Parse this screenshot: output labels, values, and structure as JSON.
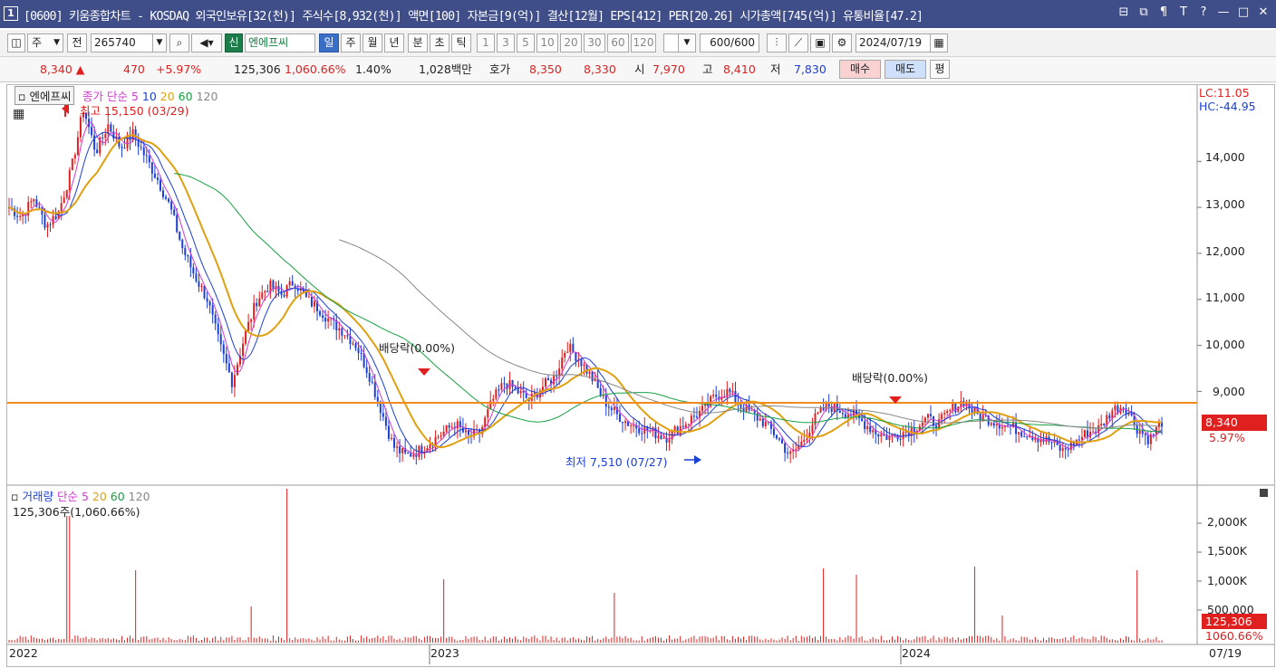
{
  "window": {
    "number": "1",
    "title": "[0600] 키움종합차트 - KOSDAQ 외국인보유[32(천)] 주식수[8,932(천)] 액면[100] 자본금[9(억)] 결산[12월] EPS[412] PER[20.26] 시가총액[745(억)] 유통비율[47.2]",
    "controls": [
      "⊟",
      "⧉",
      "¶",
      "T",
      "?",
      "—",
      "□",
      "✕"
    ]
  },
  "toolbar": {
    "market": "주",
    "prev_label": "전",
    "code": "265740",
    "new_badge": "신",
    "stock_name": "엔에프씨",
    "periods": [
      "일",
      "주",
      "월",
      "년",
      "분",
      "초",
      "틱"
    ],
    "active_period": "일",
    "minutes": [
      "1",
      "3",
      "5",
      "10",
      "20",
      "30",
      "60",
      "120"
    ],
    "count": "600/600",
    "date": "2024/07/19"
  },
  "info": {
    "price": "8,340",
    "change": "470",
    "change_pct": "+5.97%",
    "volume": "125,306",
    "volume_ratio": "1,060.66%",
    "turnover": "1.40%",
    "amount": "1,028백만",
    "quote_label": "호가",
    "ask": "8,350",
    "bid": "8,330",
    "open_label": "시",
    "open": "7,970",
    "high_label": "고",
    "high": "8,410",
    "low_label": "저",
    "low": "7,830",
    "buy_label": "매수",
    "sell_label": "매도",
    "flat_label": "평"
  },
  "price_panel": {
    "stock_tag": "엔에프씨",
    "ma_legend": [
      "종가 단순 5",
      "10",
      "20",
      "60",
      "120"
    ],
    "high_note": "최고 15,150 (03/29)",
    "low_note": "최저 7,510 (07/27)",
    "dividend_note_1": "배당락(0.00%)",
    "dividend_note_2": "배당락(0.00%)",
    "lc": "LC:11.05",
    "hc": "HC:-44.95",
    "y_ticks": [
      "14,000",
      "13,000",
      "12,000",
      "11,000",
      "10,000",
      "9,000"
    ],
    "last_price": "8,340",
    "last_pct": "5.97%"
  },
  "volume_panel": {
    "legend": [
      "거래량",
      "단순 5",
      "20",
      "60",
      "120"
    ],
    "current": "125,306주(1,060.66%)",
    "y_ticks": [
      "2,000K",
      "1,500K",
      "1,000K",
      "500,000"
    ],
    "last_volume": "125,306",
    "last_ratio": "1060.66%"
  },
  "x_axis": [
    "2022",
    "2023",
    "2024",
    "07/19"
  ],
  "chart_data": {
    "type": "line",
    "series": [
      {
        "values": [
          13000,
          12800,
          13200,
          12600,
          12900,
          13800,
          15150,
          14200,
          14800,
          14300,
          14600,
          14100,
          13600,
          13000,
          12100,
          11500,
          11000,
          10000,
          9200,
          10200,
          11000,
          11300,
          11100,
          11400,
          11000,
          10800,
          10500,
          10300,
          10000,
          9400,
          8600,
          7800,
          7600,
          7700,
          7900,
          8100,
          8300,
          8000,
          8100,
          8800,
          9200,
          9000,
          8800,
          9100,
          9300,
          10000,
          9700,
          9300,
          8800,
          8500,
          8300,
          8200,
          8100,
          8000,
          8200,
          8400,
          8600,
          8900,
          9000,
          8700,
          8500,
          8300,
          8000,
          7600,
          7900,
          8400,
          8700,
          8600,
          8500,
          8300,
          8100,
          8000,
          8100,
          8200,
          8400,
          8300,
          8600,
          8800,
          8500,
          8400,
          8300,
          8200,
          8100,
          8000,
          7900,
          7700,
          7900,
          8100,
          8200,
          8600,
          8700,
          8200,
          7950,
          8340
        ]
      }
    ],
    "ylim": [
      7000,
      15600
    ]
  }
}
